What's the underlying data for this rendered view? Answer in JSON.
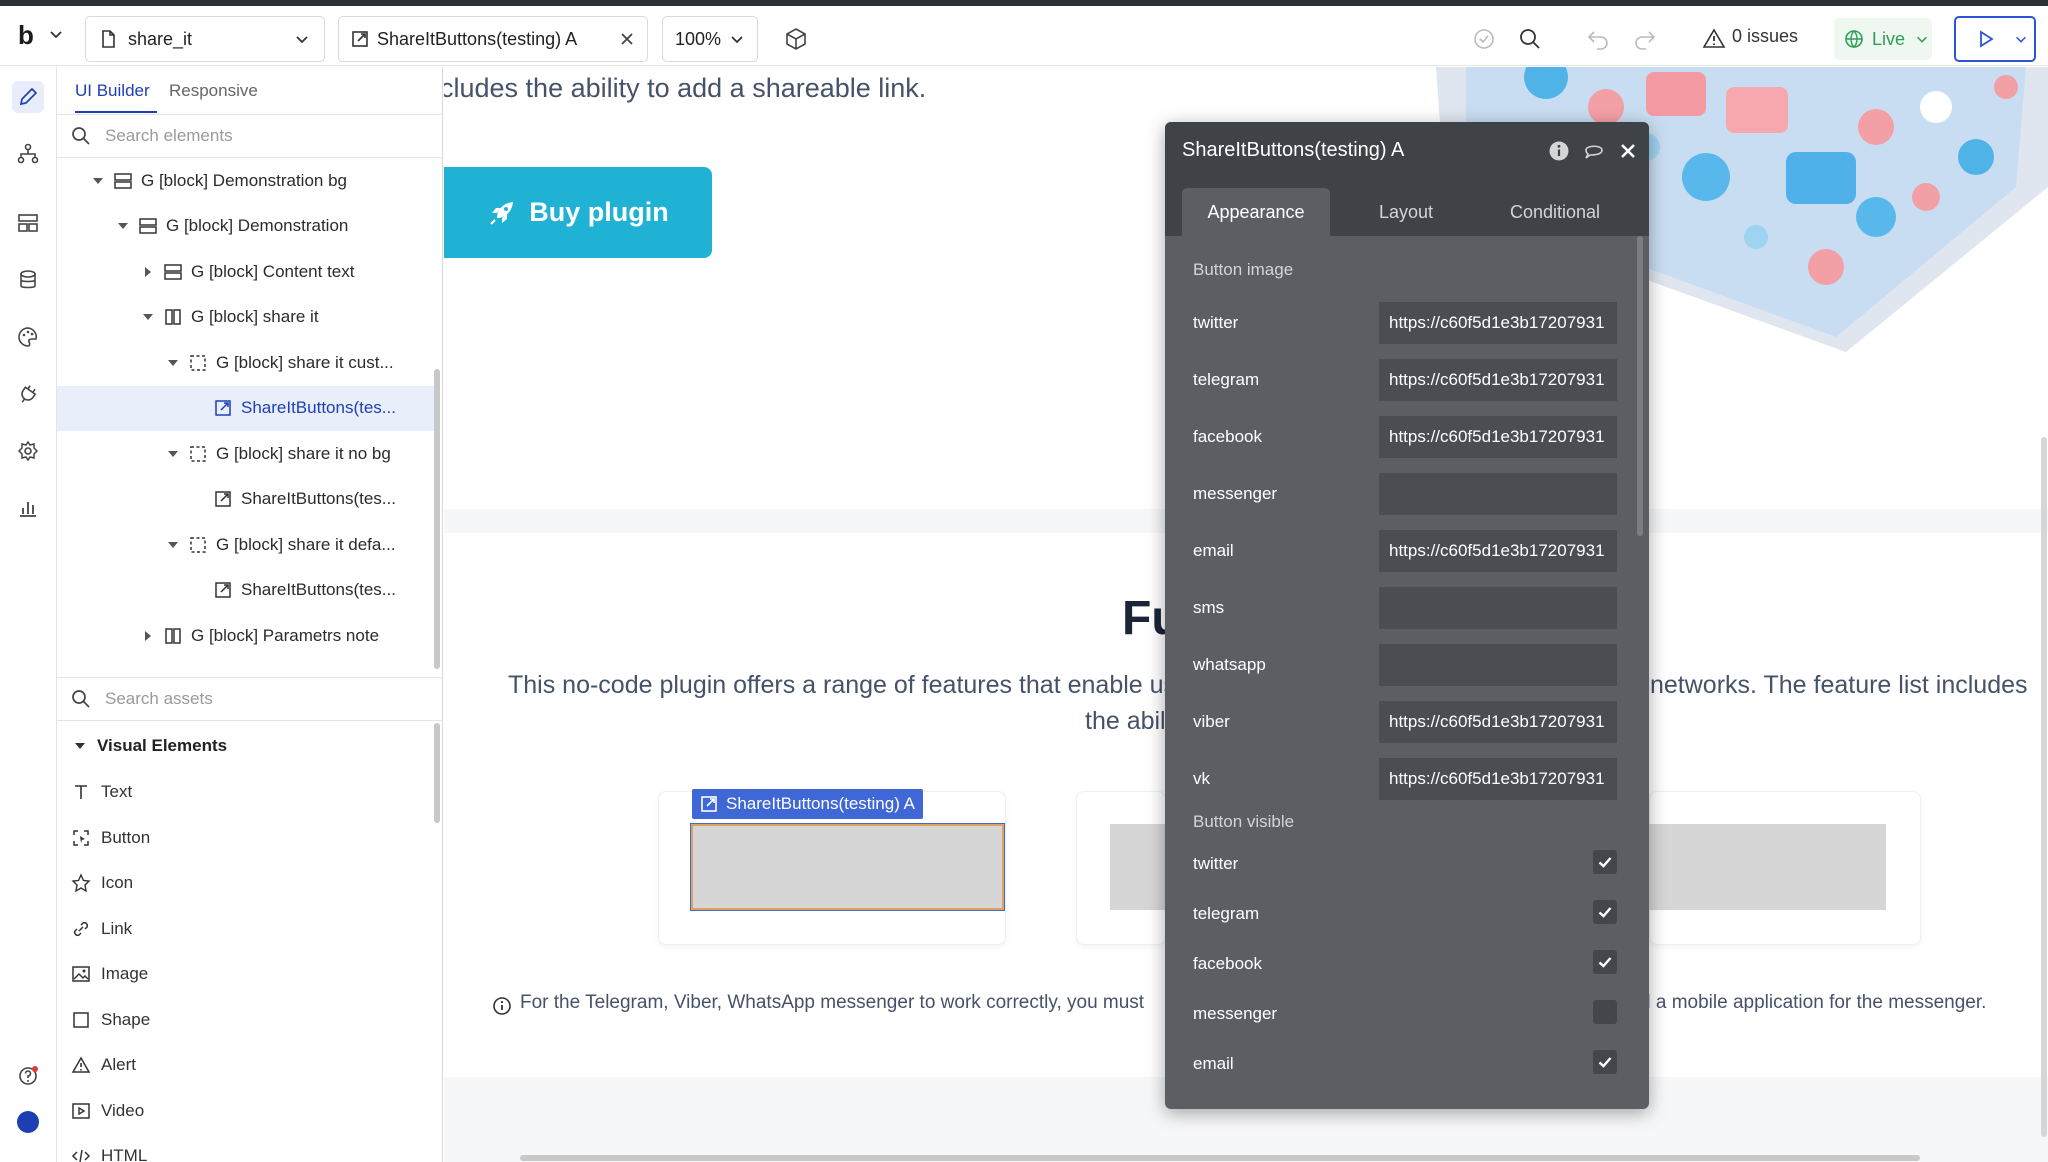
{
  "toolbar": {
    "logo": "b",
    "page_name": "share_it",
    "element_name": "ShareItButtons(testing) A",
    "zoom": "100%",
    "issues": "0 issues",
    "live_label": "Live"
  },
  "panel": {
    "tabs": [
      "UI Builder",
      "Responsive"
    ],
    "search_elements_placeholder": "Search elements",
    "search_assets_placeholder": "Search assets",
    "tree": [
      {
        "label": "G [block] Demonstration bg",
        "depth": 0,
        "expanded": true,
        "icon": "rows-icon"
      },
      {
        "label": "G [block] Demonstration",
        "depth": 1,
        "expanded": true,
        "icon": "rows-icon"
      },
      {
        "label": "G [block] Content text",
        "depth": 2,
        "expanded": false,
        "icon": "rows-icon"
      },
      {
        "label": "G [block] share it",
        "depth": 2,
        "expanded": true,
        "icon": "columns-icon"
      },
      {
        "label": "G [block] share it cust...",
        "depth": 3,
        "expanded": true,
        "icon": "dashed-box-icon"
      },
      {
        "label": "ShareItButtons(tes...",
        "depth": 4,
        "selected": true,
        "icon": "external-link-icon"
      },
      {
        "label": "G [block] share it no bg",
        "depth": 3,
        "expanded": true,
        "icon": "dashed-box-icon"
      },
      {
        "label": "ShareItButtons(tes...",
        "depth": 4,
        "icon": "external-link-icon"
      },
      {
        "label": "G [block] share it defa...",
        "depth": 3,
        "expanded": true,
        "icon": "dashed-box-icon"
      },
      {
        "label": "ShareItButtons(tes...",
        "depth": 4,
        "icon": "external-link-icon"
      },
      {
        "label": "G [block] Parametrs note",
        "depth": 2,
        "expanded": false,
        "icon": "columns-icon"
      }
    ],
    "visual_elements_header": "Visual Elements",
    "visual_elements": [
      {
        "label": "Text",
        "icon": "text-icon"
      },
      {
        "label": "Button",
        "icon": "button-icon"
      },
      {
        "label": "Icon",
        "icon": "star-icon"
      },
      {
        "label": "Link",
        "icon": "link-icon"
      },
      {
        "label": "Image",
        "icon": "image-icon"
      },
      {
        "label": "Shape",
        "icon": "shape-icon"
      },
      {
        "label": "Alert",
        "icon": "alert-icon"
      },
      {
        "label": "Video",
        "icon": "video-icon"
      },
      {
        "label": "HTML",
        "icon": "code-icon"
      }
    ]
  },
  "canvas": {
    "top_text": "cludes the ability to add a shareable link.",
    "buy_button": "Buy plugin",
    "features_title": "Fu",
    "desc_left": "This no-code plugin offers a range of features that enable us",
    "desc_right": "networks. The feature list includes",
    "desc_line2": "the abil",
    "selected_label": "ShareItButtons(testing) A",
    "note_left": "For the Telegram, Viber, WhatsApp messenger to work correctly, you must",
    "note_right": "d a mobile application for the messenger."
  },
  "editor": {
    "title": "ShareItButtons(testing) A",
    "tabs": [
      "Appearance",
      "Layout",
      "Conditional"
    ],
    "button_image_section": "Button image",
    "button_image": [
      {
        "label": "twitter",
        "value": "https://c60f5d1e3b17207931"
      },
      {
        "label": "telegram",
        "value": "https://c60f5d1e3b17207931"
      },
      {
        "label": "facebook",
        "value": "https://c60f5d1e3b17207931"
      },
      {
        "label": "messenger",
        "value": ""
      },
      {
        "label": "email",
        "value": "https://c60f5d1e3b17207931"
      },
      {
        "label": "sms",
        "value": ""
      },
      {
        "label": "whatsapp",
        "value": ""
      },
      {
        "label": "viber",
        "value": "https://c60f5d1e3b17207931"
      },
      {
        "label": "vk",
        "value": "https://c60f5d1e3b17207931"
      }
    ],
    "button_visible_section": "Button visible",
    "button_visible": [
      {
        "label": "twitter",
        "checked": true
      },
      {
        "label": "telegram",
        "checked": true
      },
      {
        "label": "facebook",
        "checked": true
      },
      {
        "label": "messenger",
        "checked": false
      },
      {
        "label": "email",
        "checked": true
      }
    ]
  },
  "colors": {
    "accent": "#1e3fb4",
    "buy_button": "#1fb2d4",
    "editor_bg": "#5b5e63",
    "editor_header": "#3f4246",
    "selection_label": "#3f67d6"
  }
}
